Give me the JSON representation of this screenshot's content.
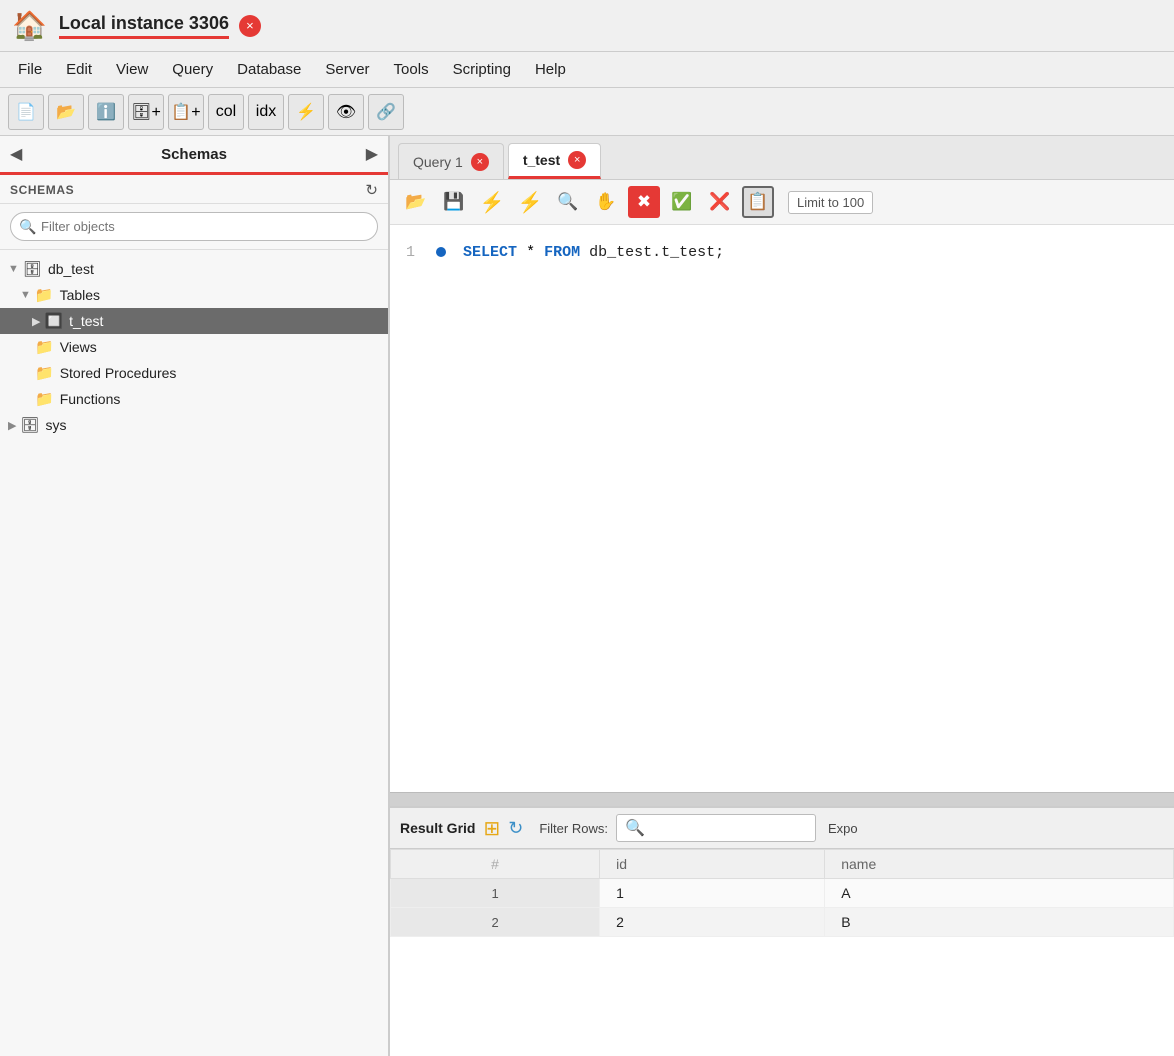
{
  "titlebar": {
    "title": "Local instance 3306",
    "close_label": "×"
  },
  "menubar": {
    "items": [
      "File",
      "Edit",
      "View",
      "Query",
      "Database",
      "Server",
      "Tools",
      "Scripting",
      "Help"
    ]
  },
  "toolbar": {
    "buttons": [
      "SQL1",
      "SQL2",
      "ℹ",
      "DB+",
      "Tbl+",
      "Col+",
      "Idx+",
      "SQL3",
      "View",
      "Conn"
    ]
  },
  "left_panel": {
    "schemas_label": "Schemas",
    "filter_placeholder": "Filter objects",
    "schemas_label_tag": "SCHEMAS",
    "refresh_icon": "↻",
    "tree": [
      {
        "level": 0,
        "icon": "🗄",
        "label": "db_test",
        "arrow": "▼",
        "id": "db_test"
      },
      {
        "level": 1,
        "icon": "📁",
        "label": "Tables",
        "arrow": "▼",
        "id": "tables"
      },
      {
        "level": 2,
        "icon": "🔲",
        "label": "t_test",
        "arrow": "▶",
        "id": "t_test",
        "selected": true
      },
      {
        "level": 1,
        "icon": "📁",
        "label": "Views",
        "arrow": "",
        "id": "views"
      },
      {
        "level": 1,
        "icon": "📁",
        "label": "Stored Procedures",
        "arrow": "",
        "id": "stored_procedures"
      },
      {
        "level": 1,
        "icon": "📁",
        "label": "Functions",
        "arrow": "",
        "id": "functions"
      },
      {
        "level": 0,
        "icon": "🗄",
        "label": "sys",
        "arrow": "▶",
        "id": "sys"
      }
    ]
  },
  "tabs": [
    {
      "label": "Query 1",
      "active": false,
      "id": "query1"
    },
    {
      "label": "t_test",
      "active": true,
      "id": "t_test"
    }
  ],
  "query_toolbar": {
    "buttons": [
      "📂",
      "💾",
      "⚡",
      "⚡",
      "🔍",
      "✋",
      "🚫",
      "✅",
      "❌",
      "📋"
    ],
    "limit_label": "Limit to 100"
  },
  "sql_editor": {
    "line": "1",
    "code": "SELECT * FROM db_test.t_test;"
  },
  "result_grid": {
    "label": "Result Grid",
    "filter_label": "Filter Rows:",
    "export_label": "Expo",
    "columns": [
      "#",
      "id",
      "name"
    ],
    "rows": [
      {
        "row_num": "1",
        "id": "1",
        "name": "A"
      },
      {
        "row_num": "2",
        "id": "2",
        "name": "B"
      }
    ]
  }
}
